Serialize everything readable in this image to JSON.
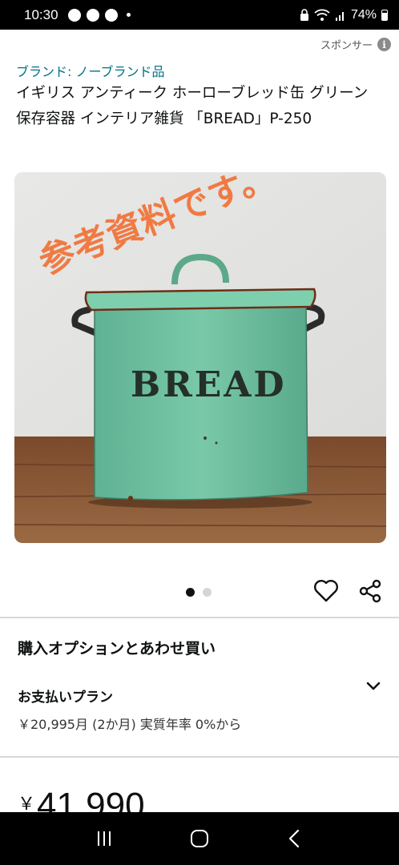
{
  "status_bar": {
    "time": "10:30",
    "battery": "74%"
  },
  "sponsor": {
    "label": "スポンサー",
    "info_glyph": "i"
  },
  "product": {
    "brand": "ブランド: ノーブランド品",
    "title": "イギリス アンティーク ホーローブレッド缶 グリーン 保存容器 インテリア雑貨 「BREAD」P-250",
    "image": {
      "overlay_text": "参考資料です。",
      "label_text": "BREAD"
    }
  },
  "carousel": {
    "total": 2,
    "active_index": 0
  },
  "purchase_options": {
    "heading": "購入オプションとあわせ買い",
    "payment_plan": {
      "heading": "お支払いプラン",
      "detail": "￥20,995月 (2か月) 実質年率 0%から"
    }
  },
  "price": {
    "currency": "￥",
    "amount": "41,990"
  },
  "icons": {
    "heart": "heart-icon",
    "share": "share-icon",
    "chevron": "chevron-down-icon",
    "nav_recents": "recents-icon",
    "nav_home": "home-icon",
    "nav_back": "back-icon"
  },
  "colors": {
    "link": "#007185",
    "overlay_text": "#f07a43",
    "tin_green": "#6fc0a0"
  }
}
